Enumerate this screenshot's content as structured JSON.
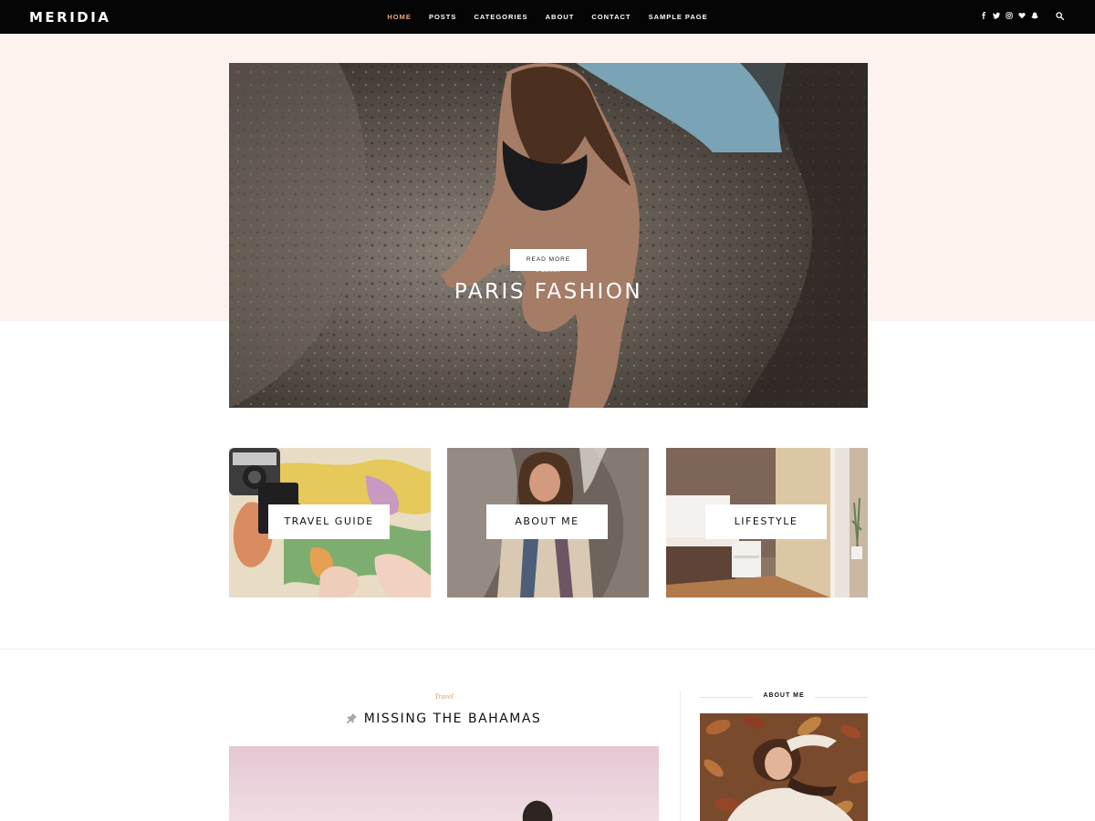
{
  "site": {
    "logo": "MERIDIA"
  },
  "nav": {
    "items": [
      {
        "label": "HOME",
        "active": true
      },
      {
        "label": "POSTS",
        "active": false
      },
      {
        "label": "CATEGORIES",
        "active": false
      },
      {
        "label": "ABOUT",
        "active": false
      },
      {
        "label": "CONTACT",
        "active": false
      },
      {
        "label": "SAMPLE PAGE",
        "active": false
      }
    ],
    "social_icons": [
      "facebook-icon",
      "twitter-icon",
      "instagram-icon",
      "heart-icon",
      "snapchat-icon"
    ],
    "search_icon": "search-icon",
    "accent_color": "#e8a97b"
  },
  "hero": {
    "category": "Fashion",
    "title": "PARIS FASHION",
    "button": "READ MORE",
    "band_color": "#fdf3ee"
  },
  "promos": [
    {
      "label": "TRAVEL GUIDE"
    },
    {
      "label": "ABOUT ME"
    },
    {
      "label": "LIFESTYLE"
    }
  ],
  "post": {
    "category": "Travel",
    "title": "MISSING THE BAHAMAS",
    "pin_icon": "pin-icon"
  },
  "sidebar": {
    "widget_title": "ABOUT ME"
  }
}
